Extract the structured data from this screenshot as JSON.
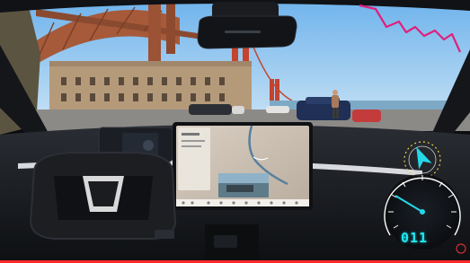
{
  "scene": {
    "description_tags": [
      "car-interior",
      "windshield-view",
      "golden-gate-bridge",
      "fort-building",
      "touchscreen-map",
      "steering-yoke",
      "speed-overlay"
    ]
  },
  "overlay": {
    "speed_value": "011",
    "playback_progress": 1.0,
    "colors": {
      "speed_digits": "#22e8f0",
      "altitude_trace": "#e0207a",
      "compass_arrow": "#25d7e8",
      "progress_bar": "#ff2a2a"
    }
  }
}
